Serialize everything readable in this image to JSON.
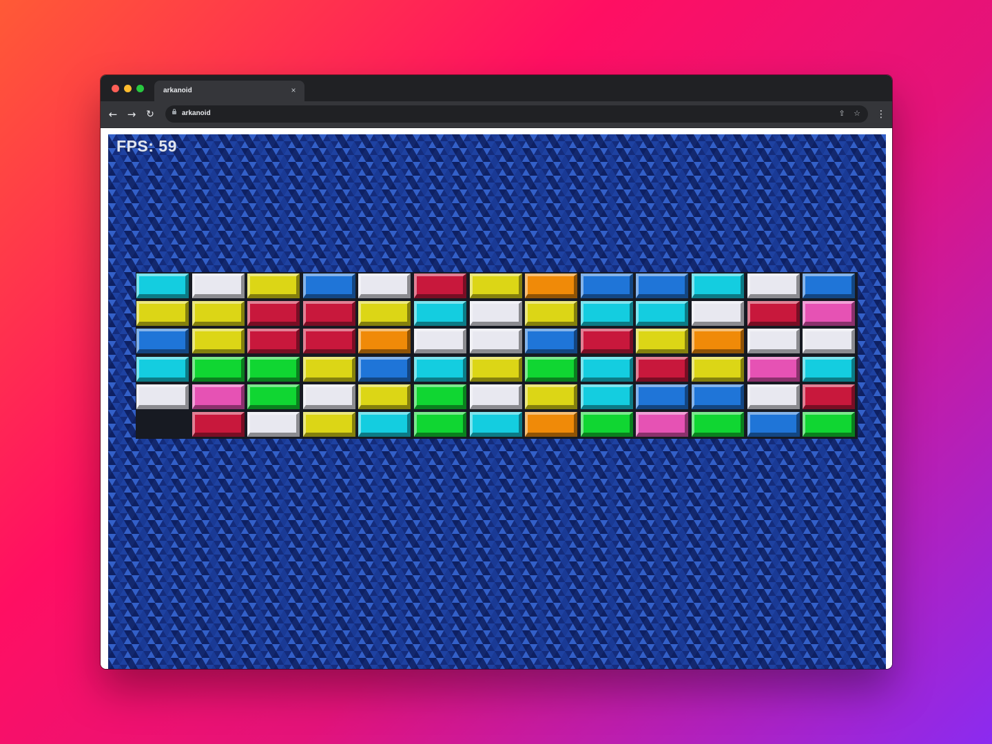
{
  "browser": {
    "tab_title": "arkanoid",
    "url": "arkanoid",
    "close_glyph": "×",
    "back_glyph": "←",
    "forward_glyph": "→",
    "reload_glyph": "↻",
    "share_glyph": "⇪",
    "star_glyph": "☆",
    "menu_glyph": "⋮"
  },
  "game": {
    "fps_text": "FPS: 59",
    "background_color": "#1f3f99",
    "palette": {
      "cyan": "#14cde0",
      "white": "#e8e8f0",
      "yellow": "#dcd616",
      "blue": "#1f75d8",
      "red": "#c8183c",
      "orange": "#f08a08",
      "pink": "#e652b4",
      "green": "#10d632"
    },
    "bricks": [
      [
        "cyan",
        "white",
        "yellow",
        "blue",
        "white",
        "red",
        "yellow",
        "orange",
        "blue",
        "blue",
        "cyan",
        "white",
        "blue"
      ],
      [
        "yellow",
        "yellow",
        "red",
        "red",
        "yellow",
        "cyan",
        "white",
        "yellow",
        "cyan",
        "cyan",
        "white",
        "red",
        "pink"
      ],
      [
        "blue",
        "yellow",
        "red",
        "red",
        "orange",
        "white",
        "white",
        "blue",
        "red",
        "yellow",
        "orange",
        "white",
        "white"
      ],
      [
        "cyan",
        "green",
        "green",
        "yellow",
        "blue",
        "cyan",
        "yellow",
        "green",
        "cyan",
        "red",
        "yellow",
        "pink",
        "cyan"
      ],
      [
        "white",
        "pink",
        "green",
        "white",
        "yellow",
        "green",
        "white",
        "yellow",
        "cyan",
        "blue",
        "blue",
        "white",
        "red"
      ],
      [
        null,
        "red",
        "white",
        "yellow",
        "cyan",
        "green",
        "cyan",
        "orange",
        "green",
        "pink",
        "green",
        "blue",
        "green"
      ]
    ]
  }
}
